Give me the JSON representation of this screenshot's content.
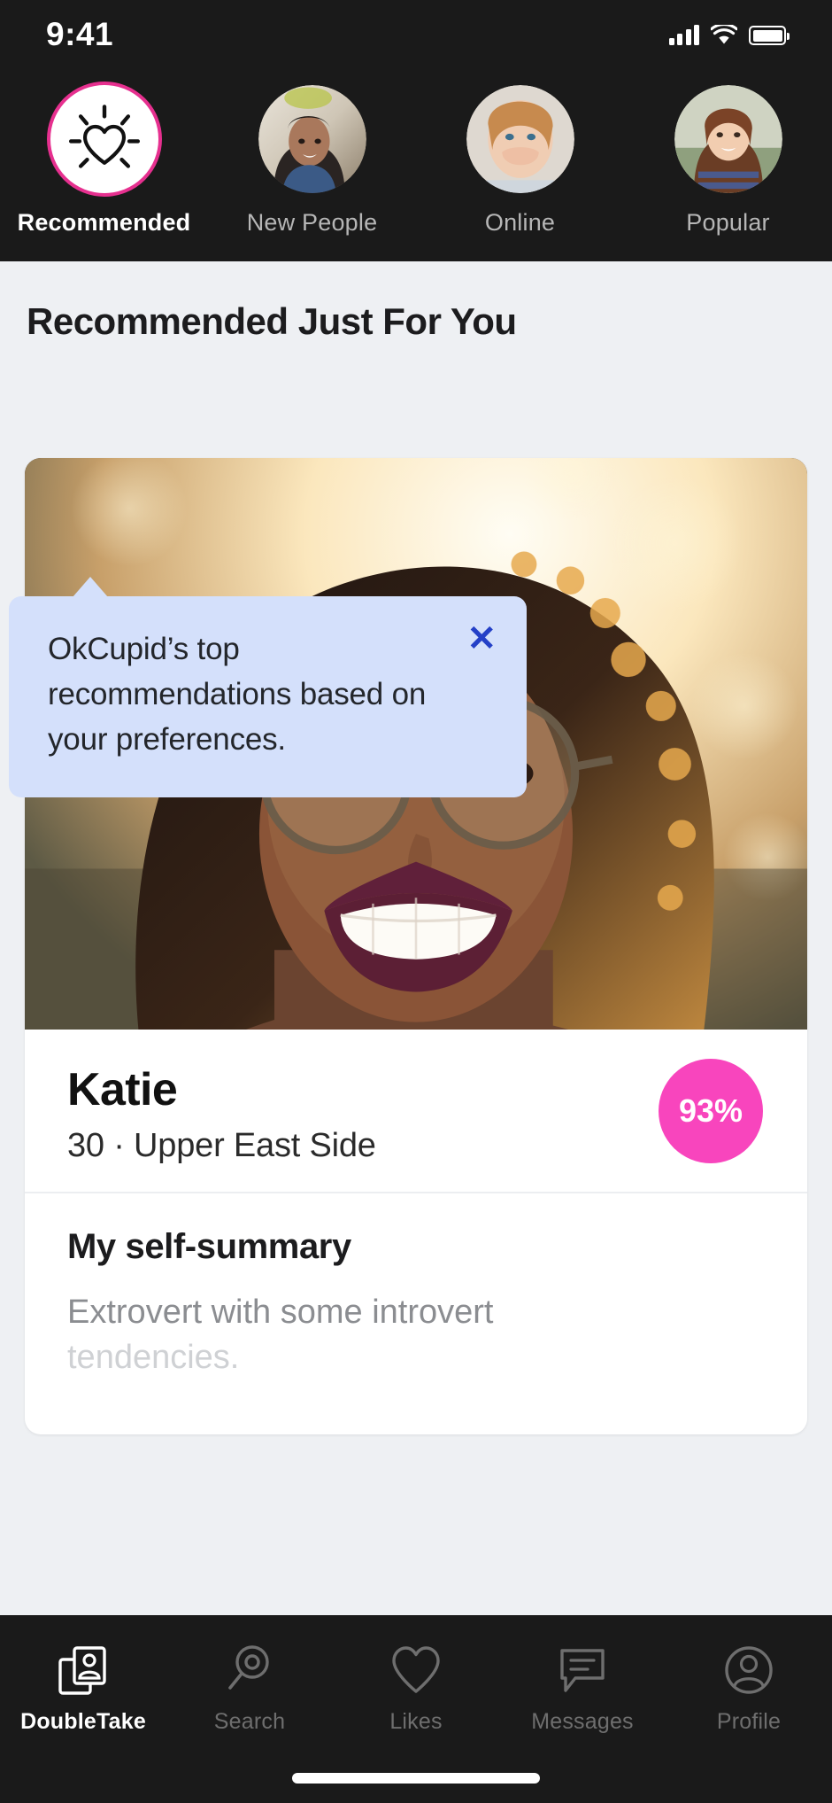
{
  "status_bar": {
    "time": "9:41",
    "signal_icon": "cellular-bars-icon",
    "wifi_icon": "wifi-icon",
    "battery_icon": "battery-full-icon"
  },
  "stories": {
    "items": [
      {
        "label": "Recommended",
        "icon": "sparkle-heart-icon",
        "active": true
      },
      {
        "label": "New People",
        "icon": "avatar-photo",
        "active": false
      },
      {
        "label": "Online",
        "icon": "avatar-photo",
        "active": false
      },
      {
        "label": "Popular",
        "icon": "avatar-photo",
        "active": false
      }
    ]
  },
  "main": {
    "section_title": "Recommended Just For You"
  },
  "tooltip": {
    "text": "OkCupid’s top recommendations based on your preferences.",
    "close_label": "✕",
    "background_color": "#d4e0fb",
    "close_color": "#2440c7"
  },
  "profile_card": {
    "name": "Katie",
    "meta": "30 · Upper East Side",
    "match_percent": "93%",
    "match_color": "#f845bd",
    "summary_heading": "My self-summary",
    "summary_line1": "Extrovert with some introvert",
    "summary_line2": "tendencies."
  },
  "tab_bar": {
    "items": [
      {
        "label": "DoubleTake",
        "icon": "double-photo-person-icon",
        "active": true
      },
      {
        "label": "Search",
        "icon": "search-icon",
        "active": false
      },
      {
        "label": "Likes",
        "icon": "heart-icon",
        "active": false
      },
      {
        "label": "Messages",
        "icon": "message-bubble-icon",
        "active": false
      },
      {
        "label": "Profile",
        "icon": "person-circle-icon",
        "active": false
      }
    ]
  }
}
